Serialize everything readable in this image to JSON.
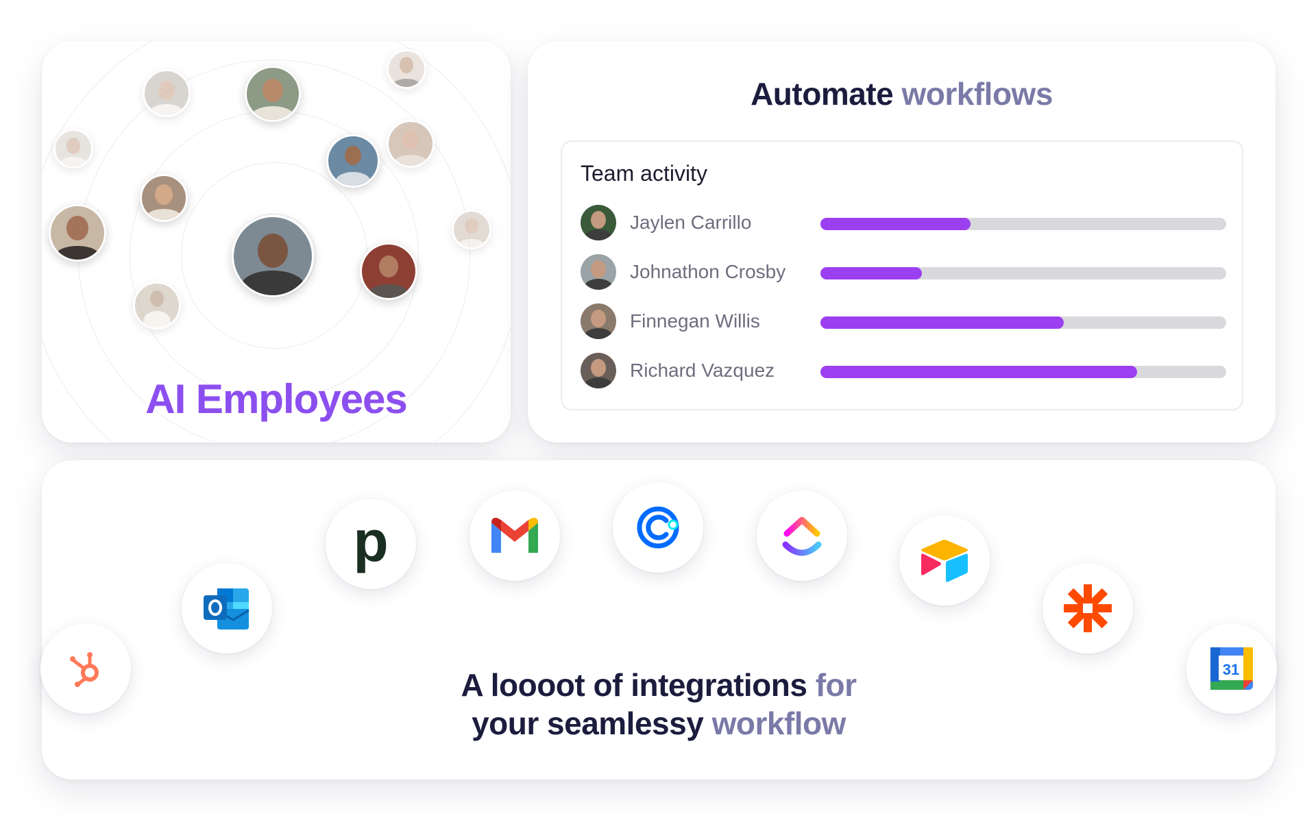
{
  "ai_card": {
    "title": "AI Employees",
    "avatars": [
      {
        "name": "center",
        "color": "#5b4a3f"
      },
      {
        "name": "a1",
        "color": "#8d9a86"
      },
      {
        "name": "a2",
        "color": "#b9b3aa"
      },
      {
        "name": "a3",
        "color": "#c9c1b6"
      },
      {
        "name": "a4",
        "color": "#6b7a8a"
      },
      {
        "name": "a5",
        "color": "#a8907e"
      },
      {
        "name": "a6",
        "color": "#c7b7a5"
      },
      {
        "name": "a7",
        "color": "#8e5b4d"
      },
      {
        "name": "a8",
        "color": "#c2b8a6"
      },
      {
        "name": "a9",
        "color": "#d9ccc1"
      },
      {
        "name": "a10",
        "color": "#b89a84"
      },
      {
        "name": "a11",
        "color": "#cbbfb2"
      }
    ]
  },
  "automate_card": {
    "title_dark": "Automate",
    "title_light": "workflows",
    "activity_title": "Team activity",
    "members": [
      {
        "name": "Jaylen Carrillo",
        "progress": 0.37,
        "color": "#3a5a3a"
      },
      {
        "name": "Johnathon Crosby",
        "progress": 0.25,
        "color": "#9aa3a6"
      },
      {
        "name": "Finnegan Willis",
        "progress": 0.6,
        "color": "#8a7a6c"
      },
      {
        "name": "Richard Vazquez",
        "progress": 0.78,
        "color": "#6a5f58"
      }
    ],
    "accent": "#9b3ff0"
  },
  "integrations_card": {
    "line1_dark": "A loooot of integrations",
    "line1_light": "for",
    "line2_dark": "your seamlessy",
    "line2_light": "workflow",
    "logos": [
      {
        "name": "hubspot-logo",
        "color": "#ff7a59"
      },
      {
        "name": "outlook-logo",
        "color": "#0f6cbd"
      },
      {
        "name": "pipedrive-logo",
        "color": "#1a2e22",
        "glyph": "p"
      },
      {
        "name": "gmail-logo",
        "color": "#ea4335"
      },
      {
        "name": "calendly-logo",
        "color": "#006bff"
      },
      {
        "name": "clickup-logo",
        "color": "#7b68ee"
      },
      {
        "name": "airtable-logo",
        "color": "#fcb400"
      },
      {
        "name": "zapier-logo",
        "color": "#ff4a00"
      },
      {
        "name": "google-calendar-logo",
        "color": "#4285f4",
        "glyph": "31"
      }
    ]
  }
}
